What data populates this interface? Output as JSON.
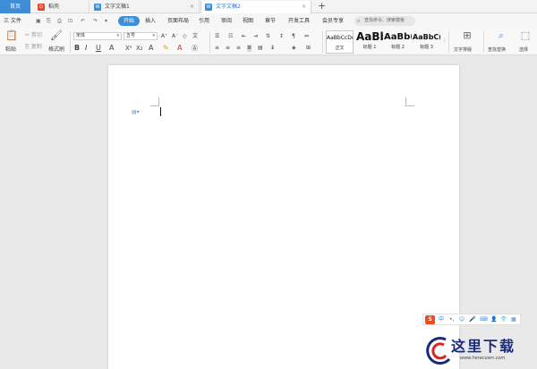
{
  "tabs": {
    "home": "首页",
    "daoke": "稻壳",
    "doc1": "文字文稿1",
    "doc2": "文字文稿2",
    "new_tab": "+"
  },
  "menu": {
    "file": "三 文件",
    "items": [
      "开始",
      "插入",
      "页面布局",
      "引用",
      "审阅",
      "视图",
      "章节",
      "开发工具",
      "会员专享"
    ],
    "search_placeholder": "查找命令、搜索模板"
  },
  "ribbon": {
    "paste": "粘贴",
    "cut": "剪切",
    "copy": "复制",
    "format_painter": "格式刷",
    "font_name": "宋体",
    "font_size": "五号",
    "styles": [
      {
        "preview": "AaBbCcDd",
        "label": "正文"
      },
      {
        "preview": "AaBb",
        "label": "标题 1"
      },
      {
        "preview": "AaBb(",
        "label": "标题 2"
      },
      {
        "preview": "AaBbC(",
        "label": "标题 3"
      }
    ],
    "text_layout": "文字排版",
    "find_replace": "查找替换",
    "select": "选择"
  },
  "ime": {
    "logo": "S",
    "lang": "中"
  },
  "watermark": {
    "title": "这里下载",
    "url": "www.herecown.com"
  },
  "colors": {
    "accent": "#3d8dd9",
    "doc_tab_text": "#2f73c8"
  }
}
